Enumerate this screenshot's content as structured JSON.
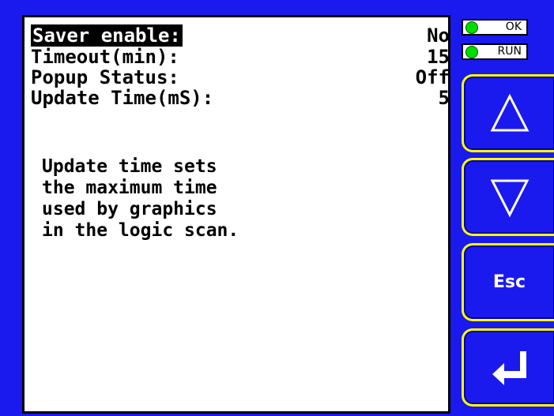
{
  "settings": {
    "rows": [
      {
        "label": "Saver enable:",
        "value": "No"
      },
      {
        "label": "Timeout(min):",
        "value": "15"
      },
      {
        "label": "Popup Status:",
        "value": "Off"
      },
      {
        "label": "Update Time(mS):",
        "value": "5"
      }
    ],
    "help_lines": [
      "Update time sets",
      "the maximum time",
      "used by graphics",
      "in the logic scan."
    ]
  },
  "status": {
    "ok_label": "OK",
    "run_label": "RUN",
    "led_color": "#00dd00"
  },
  "keys": {
    "up_icon": "up-triangle-icon",
    "down_icon": "down-triangle-icon",
    "esc_label": "Esc",
    "enter_icon": "enter-return-icon"
  },
  "colors": {
    "bezel": "#1a1aee",
    "key_border": "#ffff00",
    "screen": "#ffffff",
    "highlight": "#000000"
  }
}
